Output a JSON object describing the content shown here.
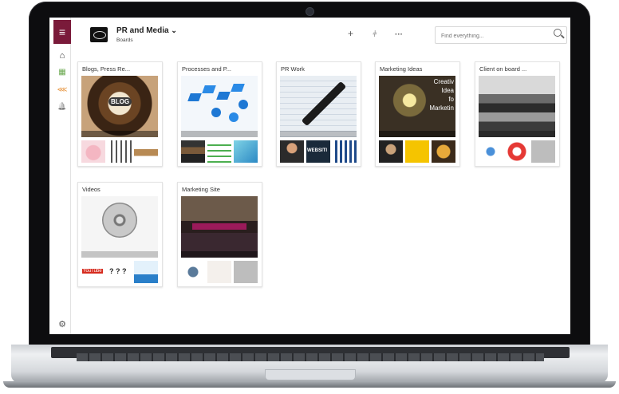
{
  "app": {
    "board_title": "PR and Media",
    "board_subtitle": "Boards",
    "menu_icon": "hamburger-icon",
    "search_placeholder": "Find everything..."
  },
  "header_buttons": {
    "add": "+",
    "filter": "⫩",
    "more": "···",
    "dropdown": "⌄"
  },
  "rail": {
    "items": [
      {
        "icon": "home-icon",
        "glyph": "⌂"
      },
      {
        "icon": "boards-icon",
        "glyph": "▦"
      },
      {
        "icon": "share-icon",
        "glyph": "⋘"
      },
      {
        "icon": "bell-icon",
        "glyph": "🔔"
      },
      {
        "icon": "settings-icon",
        "glyph": "⚙"
      }
    ]
  },
  "boards": [
    {
      "title": "Blogs, Press Re..."
    },
    {
      "title": "Processes and P..."
    },
    {
      "title": "PR Work"
    },
    {
      "title": "Marketing Ideas"
    },
    {
      "title": "Client on board ..."
    },
    {
      "title": "Videos"
    },
    {
      "title": "Marketing Site"
    }
  ],
  "cover_text": {
    "blog": "BLOG",
    "marketing_ideas_lines": [
      "Creativ",
      "Idea",
      "fo",
      "Marketin"
    ],
    "website": "WEBSITI",
    "youtube": "YouTube",
    "question": "? ? ?"
  }
}
